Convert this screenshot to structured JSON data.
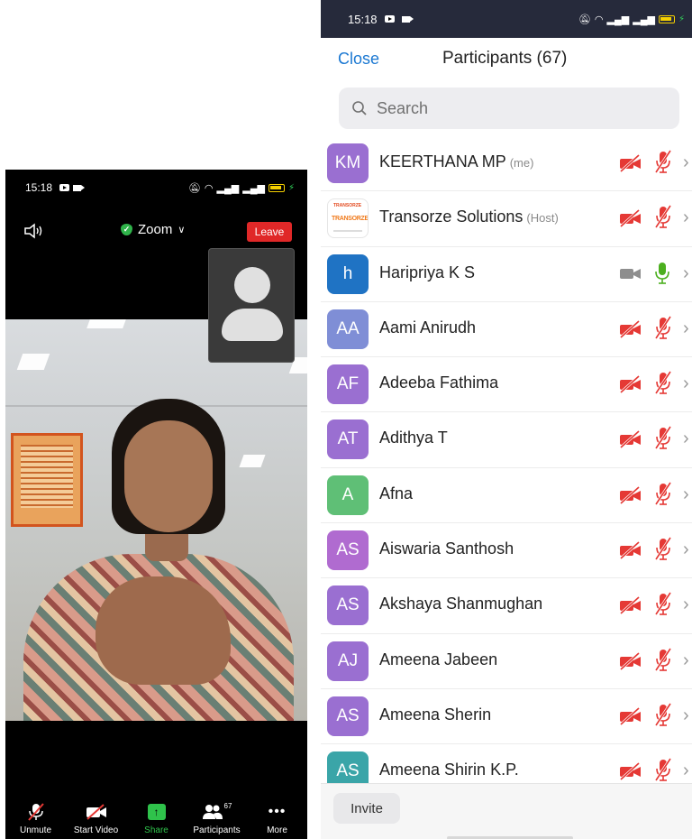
{
  "left_phone": {
    "status": {
      "time": "15:18"
    },
    "meeting": {
      "title": "Zoom",
      "leave_label": "Leave"
    },
    "toolbar": [
      {
        "label": "Unmute",
        "icon": "mic-off-icon"
      },
      {
        "label": "Start Video",
        "icon": "video-off-icon"
      },
      {
        "label": "Share",
        "icon": "share-icon"
      },
      {
        "label": "Participants",
        "icon": "participants-icon",
        "count": "67"
      },
      {
        "label": "More",
        "icon": "more-icon"
      }
    ]
  },
  "right_phone": {
    "status": {
      "time": "15:18"
    },
    "header": {
      "close_label": "Close",
      "title": "Participants (67)"
    },
    "search": {
      "placeholder": "Search"
    },
    "participants": [
      {
        "initials": "KM",
        "name": "KEERTHANA MP",
        "tag": "(me)",
        "avatar_color": "#9a6fd1",
        "video_on": false,
        "mic_on": false
      },
      {
        "initials": "",
        "name": "Transorze Solutions",
        "tag": "(Host)",
        "avatar_color": "logo",
        "logo_text": "TRANSORZE",
        "video_on": false,
        "mic_on": false
      },
      {
        "initials": "h",
        "name": "Haripriya K S",
        "tag": "",
        "avatar_color": "#1f73c4",
        "video_on": true,
        "mic_on": true
      },
      {
        "initials": "AA",
        "name": "Aami Anirudh",
        "tag": "",
        "avatar_color": "#7f8ed6",
        "video_on": false,
        "mic_on": false
      },
      {
        "initials": "AF",
        "name": "Adeeba Fathima",
        "tag": "",
        "avatar_color": "#9a6fd1",
        "video_on": false,
        "mic_on": false
      },
      {
        "initials": "AT",
        "name": "Adithya T",
        "tag": "",
        "avatar_color": "#9a6fd1",
        "video_on": false,
        "mic_on": false
      },
      {
        "initials": "A",
        "name": "Afna",
        "tag": "",
        "avatar_color": "#5fbf76",
        "video_on": false,
        "mic_on": false
      },
      {
        "initials": "AS",
        "name": "Aiswaria Santhosh",
        "tag": "",
        "avatar_color": "#b06bd0",
        "video_on": false,
        "mic_on": false
      },
      {
        "initials": "AS",
        "name": "Akshaya Shanmughan",
        "tag": "",
        "avatar_color": "#9a6fd1",
        "video_on": false,
        "mic_on": false
      },
      {
        "initials": "AJ",
        "name": "Ameena Jabeen",
        "tag": "",
        "avatar_color": "#9a6fd1",
        "video_on": false,
        "mic_on": false
      },
      {
        "initials": "AS",
        "name": "Ameena Sherin",
        "tag": "",
        "avatar_color": "#9a6fd1",
        "video_on": false,
        "mic_on": false
      },
      {
        "initials": "AS",
        "name": "Ameena Shirin K.P.",
        "tag": "",
        "avatar_color": "#3aa5a8",
        "video_on": false,
        "mic_on": false
      }
    ],
    "invite_label": "Invite"
  },
  "colors": {
    "leave": "#e02828",
    "close_link": "#1b78d2",
    "muted_red": "#e53935",
    "mic_on_green": "#4caf1f",
    "share_green": "#2fc24b"
  }
}
